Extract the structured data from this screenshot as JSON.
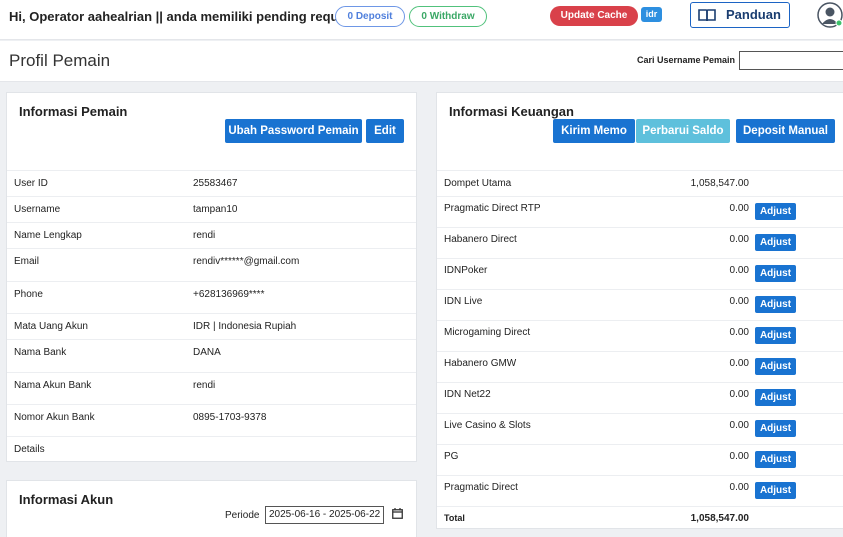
{
  "header": {
    "greeting": "Hi, Operator aahealrian || anda memiliki pending request:",
    "deposit_pill": "0 Deposit",
    "withdraw_pill": "0 Withdraw",
    "update_cache": "Update Cache",
    "currency_badge": "idr",
    "panduan": "Panduan",
    "icons": [
      "book-icon",
      "user-avatar-icon"
    ]
  },
  "page": {
    "title": "Profil Pemain",
    "search_label": "Cari Username Pemain",
    "search_value": ""
  },
  "player_info": {
    "title": "Informasi Pemain",
    "btn_change_password": "Ubah Password Pemain",
    "btn_edit": "Edit",
    "rows": [
      {
        "label": "User ID",
        "value": "25583467"
      },
      {
        "label": "Username",
        "value": "tampan10"
      },
      {
        "label": "Name Lengkap",
        "value": "rendi"
      },
      {
        "label": "Email",
        "value": "rendiv******@gmail.com"
      },
      {
        "label": "Phone",
        "value": "+628136969****"
      },
      {
        "label": "Mata Uang Akun",
        "value": "IDR | Indonesia Rupiah"
      },
      {
        "label": "Nama Bank",
        "value": "DANA"
      },
      {
        "label": "Nama Akun Bank",
        "value": "rendi"
      },
      {
        "label": "Nomor Akun Bank",
        "value": "0895-1703-9378"
      },
      {
        "label": "Details",
        "value": ""
      }
    ]
  },
  "account_info": {
    "title": "Informasi Akun",
    "periode_label": "Periode",
    "periode_value": "2025-06-16 - 2025-06-22"
  },
  "finance": {
    "title": "Informasi Keuangan",
    "btn_memo": "Kirim Memo",
    "btn_refresh": "Perbarui Saldo",
    "btn_deposit": "Deposit Manual",
    "adjust_label": "Adjust",
    "rows": [
      {
        "label": "Dompet Utama",
        "amount": "1,058,547.00"
      },
      {
        "label": "Pragmatic Direct RTP",
        "amount": "0.00"
      },
      {
        "label": "Habanero Direct",
        "amount": "0.00"
      },
      {
        "label": "IDNPoker",
        "amount": "0.00"
      },
      {
        "label": "IDN Live",
        "amount": "0.00"
      },
      {
        "label": "Microgaming Direct",
        "amount": "0.00"
      },
      {
        "label": "Habanero GMW",
        "amount": "0.00"
      },
      {
        "label": "IDN Net22",
        "amount": "0.00"
      },
      {
        "label": "Live Casino & Slots",
        "amount": "0.00"
      },
      {
        "label": "PG",
        "amount": "0.00"
      },
      {
        "label": "Pragmatic Direct",
        "amount": "0.00"
      }
    ],
    "total_label": "Total",
    "total_amount": "1,058,547.00"
  }
}
